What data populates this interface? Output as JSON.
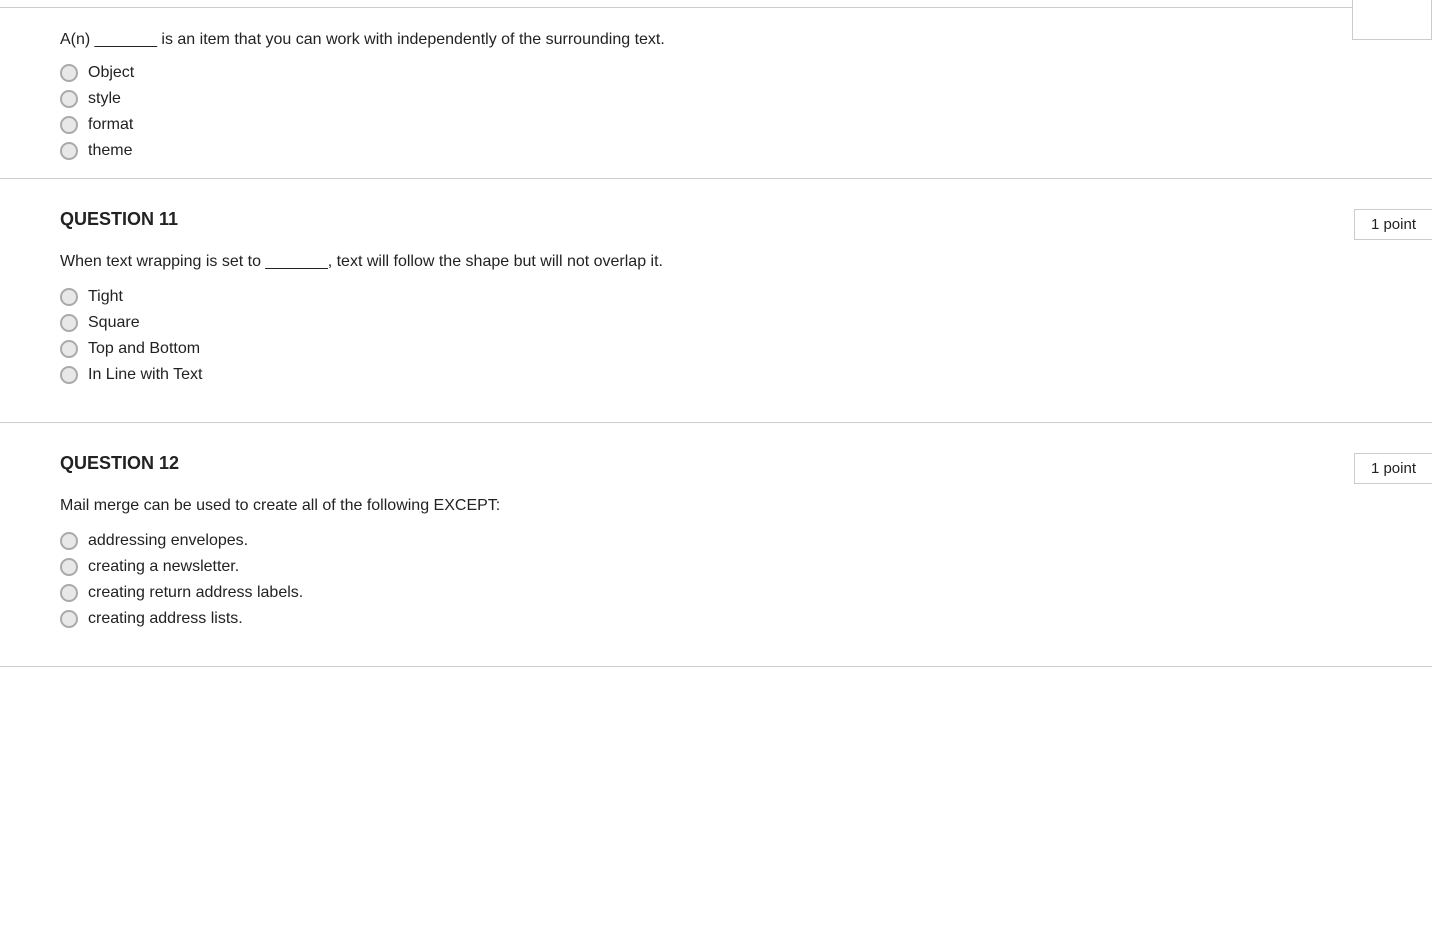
{
  "page": {
    "top_box": ""
  },
  "question10": {
    "intro_text": "A(n) _______ is an item that you can work with independently of the surrounding text.",
    "options": [
      "Object",
      "style",
      "format",
      "theme"
    ]
  },
  "question11": {
    "number": "QUESTION 11",
    "points": "1 point",
    "text": "When text wrapping is set to _______, text will follow the shape but will not overlap it.",
    "options": [
      "Tight",
      "Square",
      "Top and Bottom",
      "In Line with Text"
    ]
  },
  "question12": {
    "number": "QUESTION 12",
    "points": "1 point",
    "text": "Mail merge can be used to create all of the following EXCEPT:",
    "options": [
      "addressing envelopes.",
      "creating a newsletter.",
      "creating return address labels.",
      "creating address lists."
    ]
  }
}
